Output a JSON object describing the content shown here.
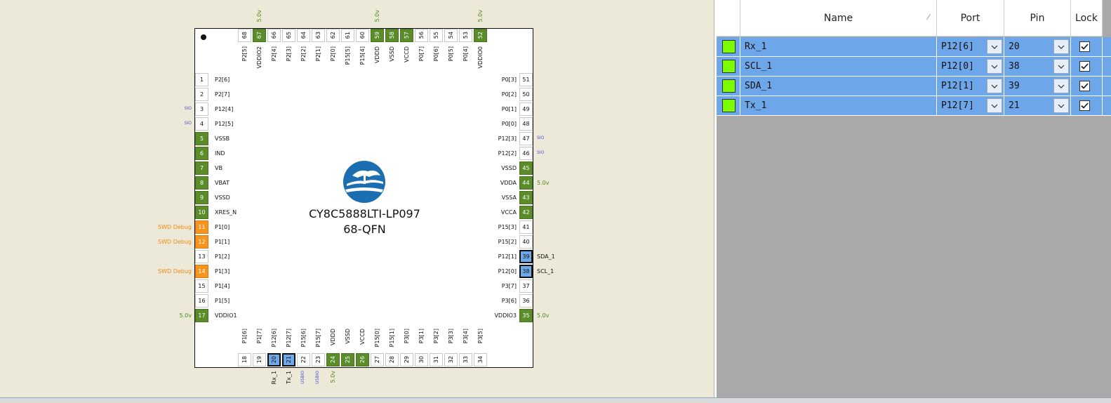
{
  "chip": {
    "name": "CY8C5888LTI-LP097",
    "package": "68-QFN",
    "left_pins": [
      {
        "num": "1",
        "label": "P2[6]",
        "type": "normal",
        "ext": "",
        "ext_color": ""
      },
      {
        "num": "2",
        "label": "P2[7]",
        "type": "normal",
        "ext": "",
        "ext_color": ""
      },
      {
        "num": "3",
        "label": "P12[4]",
        "type": "normal",
        "ext": "SIO",
        "ext_color": "blue"
      },
      {
        "num": "4",
        "label": "P12[5]",
        "type": "normal",
        "ext": "SIO",
        "ext_color": "blue"
      },
      {
        "num": "5",
        "label": "VSSB",
        "type": "power",
        "ext": "",
        "ext_color": ""
      },
      {
        "num": "6",
        "label": "IND",
        "type": "power",
        "ext": "",
        "ext_color": ""
      },
      {
        "num": "7",
        "label": "VB",
        "type": "power",
        "ext": "",
        "ext_color": ""
      },
      {
        "num": "8",
        "label": "VBAT",
        "type": "power",
        "ext": "",
        "ext_color": ""
      },
      {
        "num": "9",
        "label": "VSSD",
        "type": "power",
        "ext": "",
        "ext_color": ""
      },
      {
        "num": "10",
        "label": "XRES_N",
        "type": "power",
        "ext": "",
        "ext_color": ""
      },
      {
        "num": "11",
        "label": "P1[0]",
        "type": "swd",
        "ext": "SWD Debug",
        "ext_color": "orange"
      },
      {
        "num": "12",
        "label": "P1[1]",
        "type": "swd",
        "ext": "SWD Debug",
        "ext_color": "orange"
      },
      {
        "num": "13",
        "label": "P1[2]",
        "type": "normal",
        "ext": "",
        "ext_color": ""
      },
      {
        "num": "14",
        "label": "P1[3]",
        "type": "swd",
        "ext": "SWD Debug",
        "ext_color": "orange"
      },
      {
        "num": "15",
        "label": "P1[4]",
        "type": "normal",
        "ext": "",
        "ext_color": ""
      },
      {
        "num": "16",
        "label": "P1[5]",
        "type": "normal",
        "ext": "",
        "ext_color": ""
      },
      {
        "num": "17",
        "label": "VDDIO1",
        "type": "power",
        "ext": "5.0v",
        "ext_color": "green"
      }
    ],
    "right_pins": [
      {
        "num": "51",
        "label": "P0[3]",
        "type": "normal",
        "ext": "",
        "ext_color": ""
      },
      {
        "num": "50",
        "label": "P0[2]",
        "type": "normal",
        "ext": "",
        "ext_color": ""
      },
      {
        "num": "49",
        "label": "P0[1]",
        "type": "normal",
        "ext": "",
        "ext_color": ""
      },
      {
        "num": "48",
        "label": "P0[0]",
        "type": "normal",
        "ext": "",
        "ext_color": ""
      },
      {
        "num": "47",
        "label": "P12[3]",
        "type": "normal",
        "ext": "SIO",
        "ext_color": "blue"
      },
      {
        "num": "46",
        "label": "P12[2]",
        "type": "normal",
        "ext": "SIO",
        "ext_color": "blue"
      },
      {
        "num": "45",
        "label": "VSSD",
        "type": "power",
        "ext": "",
        "ext_color": ""
      },
      {
        "num": "44",
        "label": "VDDA",
        "type": "power",
        "ext": "5.0v",
        "ext_color": "green"
      },
      {
        "num": "43",
        "label": "VSSA",
        "type": "power",
        "ext": "",
        "ext_color": ""
      },
      {
        "num": "42",
        "label": "VCCA",
        "type": "power",
        "ext": "",
        "ext_color": ""
      },
      {
        "num": "41",
        "label": "P15[3]",
        "type": "normal",
        "ext": "",
        "ext_color": ""
      },
      {
        "num": "40",
        "label": "P15[2]",
        "type": "normal",
        "ext": "",
        "ext_color": ""
      },
      {
        "num": "39",
        "label": "P12[1]",
        "type": "sel",
        "ext": "SDA_1",
        "ext_color": "black"
      },
      {
        "num": "38",
        "label": "P12[0]",
        "type": "sel",
        "ext": "SCL_1",
        "ext_color": "black"
      },
      {
        "num": "37",
        "label": "P3[7]",
        "type": "normal",
        "ext": "",
        "ext_color": ""
      },
      {
        "num": "36",
        "label": "P3[6]",
        "type": "normal",
        "ext": "",
        "ext_color": ""
      },
      {
        "num": "35",
        "label": "VDDIO3",
        "type": "power",
        "ext": "5.0v",
        "ext_color": "green"
      }
    ],
    "top_pins": [
      {
        "num": "68",
        "label": "P2[5]",
        "type": "normal",
        "ext": "",
        "ext_color": ""
      },
      {
        "num": "67",
        "label": "VDDIO2",
        "type": "power",
        "ext": "5.0v",
        "ext_color": "green"
      },
      {
        "num": "66",
        "label": "P2[4]",
        "type": "normal",
        "ext": "",
        "ext_color": ""
      },
      {
        "num": "65",
        "label": "P2[3]",
        "type": "normal",
        "ext": "",
        "ext_color": ""
      },
      {
        "num": "64",
        "label": "P2[2]",
        "type": "normal",
        "ext": "",
        "ext_color": ""
      },
      {
        "num": "63",
        "label": "P2[1]",
        "type": "normal",
        "ext": "",
        "ext_color": ""
      },
      {
        "num": "62",
        "label": "P2[0]",
        "type": "normal",
        "ext": "",
        "ext_color": ""
      },
      {
        "num": "61",
        "label": "P15[5]",
        "type": "normal",
        "ext": "",
        "ext_color": ""
      },
      {
        "num": "60",
        "label": "P15[4]",
        "type": "normal",
        "ext": "",
        "ext_color": ""
      },
      {
        "num": "59",
        "label": "VDDD",
        "type": "power",
        "ext": "5.0v",
        "ext_color": "green"
      },
      {
        "num": "58",
        "label": "VSSD",
        "type": "power",
        "ext": "",
        "ext_color": ""
      },
      {
        "num": "57",
        "label": "VCCD",
        "type": "power",
        "ext": "",
        "ext_color": ""
      },
      {
        "num": "56",
        "label": "P0[7]",
        "type": "normal",
        "ext": "",
        "ext_color": ""
      },
      {
        "num": "55",
        "label": "P0[6]",
        "type": "normal",
        "ext": "",
        "ext_color": ""
      },
      {
        "num": "54",
        "label": "P0[5]",
        "type": "normal",
        "ext": "",
        "ext_color": ""
      },
      {
        "num": "53",
        "label": "P0[4]",
        "type": "normal",
        "ext": "",
        "ext_color": ""
      },
      {
        "num": "52",
        "label": "VDDIO0",
        "type": "power",
        "ext": "5.0v",
        "ext_color": "green"
      }
    ],
    "bottom_pins": [
      {
        "num": "18",
        "label": "P1[6]",
        "type": "normal",
        "ext": "",
        "ext_color": ""
      },
      {
        "num": "19",
        "label": "P1[7]",
        "type": "normal",
        "ext": "",
        "ext_color": ""
      },
      {
        "num": "20",
        "label": "P12[6]",
        "type": "sel",
        "ext": "Rx_1",
        "ext_color": "black"
      },
      {
        "num": "21",
        "label": "P12[7]",
        "type": "sel",
        "ext": "Tx_1",
        "ext_color": "black"
      },
      {
        "num": "22",
        "label": "P15[6]",
        "type": "normal",
        "ext": "USBIO",
        "ext_color": "blue"
      },
      {
        "num": "23",
        "label": "P15[7]",
        "type": "normal",
        "ext": "USBIO",
        "ext_color": "blue"
      },
      {
        "num": "24",
        "label": "VDDD",
        "type": "power",
        "ext": "5.0v",
        "ext_color": "green"
      },
      {
        "num": "25",
        "label": "VSSD",
        "type": "power",
        "ext": "",
        "ext_color": ""
      },
      {
        "num": "26",
        "label": "VCCD",
        "type": "power",
        "ext": "",
        "ext_color": ""
      },
      {
        "num": "27",
        "label": "P15[0]",
        "type": "normal",
        "ext": "",
        "ext_color": ""
      },
      {
        "num": "28",
        "label": "P15[1]",
        "type": "normal",
        "ext": "",
        "ext_color": ""
      },
      {
        "num": "29",
        "label": "P3[0]",
        "type": "normal",
        "ext": "",
        "ext_color": ""
      },
      {
        "num": "30",
        "label": "P3[1]",
        "type": "normal",
        "ext": "",
        "ext_color": ""
      },
      {
        "num": "31",
        "label": "P3[2]",
        "type": "normal",
        "ext": "",
        "ext_color": ""
      },
      {
        "num": "32",
        "label": "P3[3]",
        "type": "normal",
        "ext": "",
        "ext_color": ""
      },
      {
        "num": "33",
        "label": "P3[4]",
        "type": "normal",
        "ext": "",
        "ext_color": ""
      },
      {
        "num": "34",
        "label": "P3[5]",
        "type": "normal",
        "ext": "",
        "ext_color": ""
      }
    ]
  },
  "table": {
    "headers": {
      "name": "Name",
      "port": "Port",
      "pin": "Pin",
      "lock": "Lock"
    },
    "rows": [
      {
        "name": "Rx_1",
        "port": "P12[6]",
        "pin": "20",
        "locked": true
      },
      {
        "name": "SCL_1",
        "port": "P12[0]",
        "pin": "38",
        "locked": true
      },
      {
        "name": "SDA_1",
        "port": "P12[1]",
        "pin": "39",
        "locked": true
      },
      {
        "name": "Tx_1",
        "port": "P12[7]",
        "pin": "21",
        "locked": true
      }
    ]
  },
  "colors": {
    "power": "#5b8c2a",
    "swd": "#f7941d",
    "selected": "#6fa8e8",
    "signal": "#7cfc00"
  }
}
